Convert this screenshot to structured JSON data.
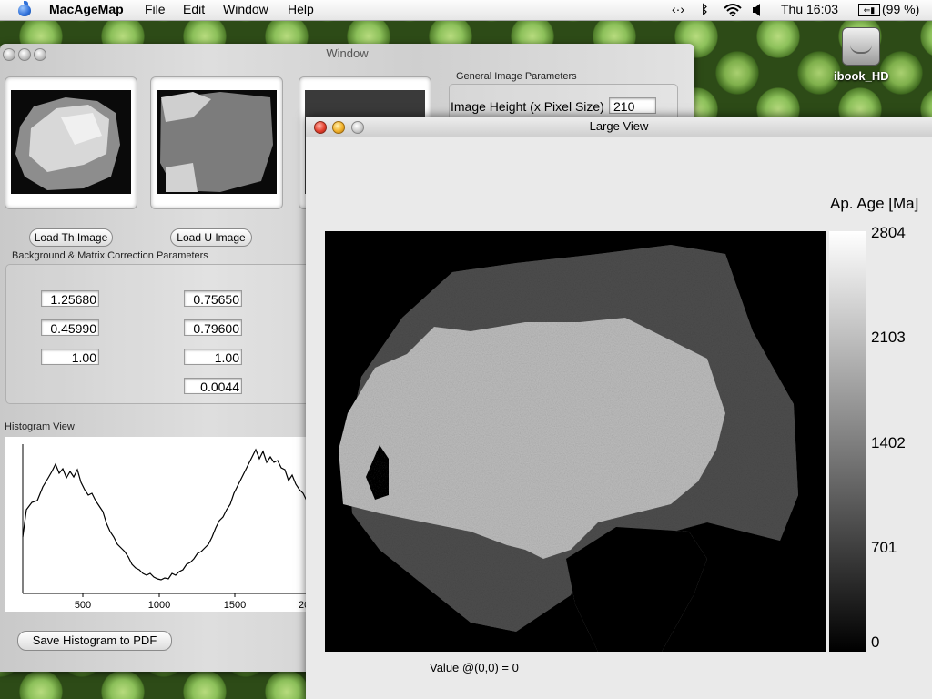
{
  "menubar": {
    "app_name": "MacAgeMap",
    "items": [
      "File",
      "Edit",
      "Window",
      "Help"
    ],
    "clock": "Thu 16:03",
    "battery": "(99 %)"
  },
  "desktop": {
    "drive_label": "ibook_HD"
  },
  "main_window": {
    "title": "Window",
    "buttons": {
      "load_th": "Load Th Image",
      "load_u": "Load U Image",
      "save_histogram": "Save Histogram to PDF"
    },
    "general_params": {
      "label": "General Image Parameters",
      "image_height_label": "Image Height (x Pixel Size)",
      "image_height_value": "210"
    },
    "correction": {
      "label": "Background & Matrix Correction Parameters",
      "left": [
        "1.25680",
        "0.45990",
        "1.00"
      ],
      "right": [
        "0.75650",
        "0.79600",
        "1.00",
        "0.0044"
      ]
    },
    "histogram": {
      "label": "Histogram View",
      "x_ticks": [
        "500",
        "1000",
        "1500",
        "20"
      ]
    }
  },
  "large_view": {
    "title": "Large View",
    "colorbar_title": "Ap. Age [Ma]",
    "colorbar_ticks": [
      "2804",
      "2103",
      "1402",
      "701",
      "0"
    ],
    "status": "Value @(0,0) = 0"
  }
}
